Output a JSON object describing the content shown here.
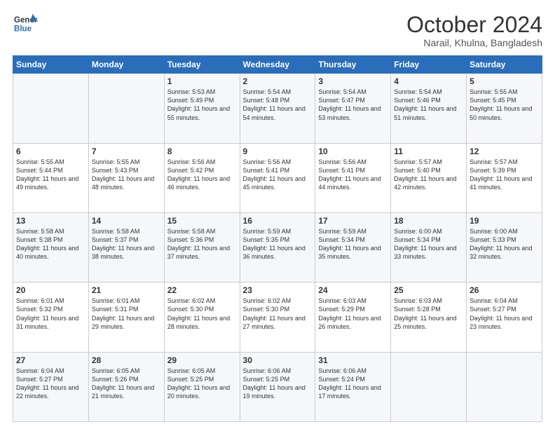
{
  "logo": {
    "line1": "General",
    "line2": "Blue"
  },
  "title": "October 2024",
  "subtitle": "Narail, Khulna, Bangladesh",
  "days_of_week": [
    "Sunday",
    "Monday",
    "Tuesday",
    "Wednesday",
    "Thursday",
    "Friday",
    "Saturday"
  ],
  "weeks": [
    [
      {
        "day": "",
        "content": ""
      },
      {
        "day": "",
        "content": ""
      },
      {
        "day": "1",
        "content": "Sunrise: 5:53 AM\nSunset: 5:49 PM\nDaylight: 11 hours and 55 minutes."
      },
      {
        "day": "2",
        "content": "Sunrise: 5:54 AM\nSunset: 5:48 PM\nDaylight: 11 hours and 54 minutes."
      },
      {
        "day": "3",
        "content": "Sunrise: 5:54 AM\nSunset: 5:47 PM\nDaylight: 11 hours and 53 minutes."
      },
      {
        "day": "4",
        "content": "Sunrise: 5:54 AM\nSunset: 5:46 PM\nDaylight: 11 hours and 51 minutes."
      },
      {
        "day": "5",
        "content": "Sunrise: 5:55 AM\nSunset: 5:45 PM\nDaylight: 11 hours and 50 minutes."
      }
    ],
    [
      {
        "day": "6",
        "content": "Sunrise: 5:55 AM\nSunset: 5:44 PM\nDaylight: 11 hours and 49 minutes."
      },
      {
        "day": "7",
        "content": "Sunrise: 5:55 AM\nSunset: 5:43 PM\nDaylight: 11 hours and 48 minutes."
      },
      {
        "day": "8",
        "content": "Sunrise: 5:56 AM\nSunset: 5:42 PM\nDaylight: 11 hours and 46 minutes."
      },
      {
        "day": "9",
        "content": "Sunrise: 5:56 AM\nSunset: 5:41 PM\nDaylight: 11 hours and 45 minutes."
      },
      {
        "day": "10",
        "content": "Sunrise: 5:56 AM\nSunset: 5:41 PM\nDaylight: 11 hours and 44 minutes."
      },
      {
        "day": "11",
        "content": "Sunrise: 5:57 AM\nSunset: 5:40 PM\nDaylight: 11 hours and 42 minutes."
      },
      {
        "day": "12",
        "content": "Sunrise: 5:57 AM\nSunset: 5:39 PM\nDaylight: 11 hours and 41 minutes."
      }
    ],
    [
      {
        "day": "13",
        "content": "Sunrise: 5:58 AM\nSunset: 5:38 PM\nDaylight: 11 hours and 40 minutes."
      },
      {
        "day": "14",
        "content": "Sunrise: 5:58 AM\nSunset: 5:37 PM\nDaylight: 11 hours and 38 minutes."
      },
      {
        "day": "15",
        "content": "Sunrise: 5:58 AM\nSunset: 5:36 PM\nDaylight: 11 hours and 37 minutes."
      },
      {
        "day": "16",
        "content": "Sunrise: 5:59 AM\nSunset: 5:35 PM\nDaylight: 11 hours and 36 minutes."
      },
      {
        "day": "17",
        "content": "Sunrise: 5:59 AM\nSunset: 5:34 PM\nDaylight: 11 hours and 35 minutes."
      },
      {
        "day": "18",
        "content": "Sunrise: 6:00 AM\nSunset: 5:34 PM\nDaylight: 11 hours and 33 minutes."
      },
      {
        "day": "19",
        "content": "Sunrise: 6:00 AM\nSunset: 5:33 PM\nDaylight: 11 hours and 32 minutes."
      }
    ],
    [
      {
        "day": "20",
        "content": "Sunrise: 6:01 AM\nSunset: 5:32 PM\nDaylight: 11 hours and 31 minutes."
      },
      {
        "day": "21",
        "content": "Sunrise: 6:01 AM\nSunset: 5:31 PM\nDaylight: 11 hours and 29 minutes."
      },
      {
        "day": "22",
        "content": "Sunrise: 6:02 AM\nSunset: 5:30 PM\nDaylight: 11 hours and 28 minutes."
      },
      {
        "day": "23",
        "content": "Sunrise: 6:02 AM\nSunset: 5:30 PM\nDaylight: 11 hours and 27 minutes."
      },
      {
        "day": "24",
        "content": "Sunrise: 6:03 AM\nSunset: 5:29 PM\nDaylight: 11 hours and 26 minutes."
      },
      {
        "day": "25",
        "content": "Sunrise: 6:03 AM\nSunset: 5:28 PM\nDaylight: 11 hours and 25 minutes."
      },
      {
        "day": "26",
        "content": "Sunrise: 6:04 AM\nSunset: 5:27 PM\nDaylight: 11 hours and 23 minutes."
      }
    ],
    [
      {
        "day": "27",
        "content": "Sunrise: 6:04 AM\nSunset: 5:27 PM\nDaylight: 11 hours and 22 minutes."
      },
      {
        "day": "28",
        "content": "Sunrise: 6:05 AM\nSunset: 5:26 PM\nDaylight: 11 hours and 21 minutes."
      },
      {
        "day": "29",
        "content": "Sunrise: 6:05 AM\nSunset: 5:25 PM\nDaylight: 11 hours and 20 minutes."
      },
      {
        "day": "30",
        "content": "Sunrise: 6:06 AM\nSunset: 5:25 PM\nDaylight: 11 hours and 19 minutes."
      },
      {
        "day": "31",
        "content": "Sunrise: 6:06 AM\nSunset: 5:24 PM\nDaylight: 11 hours and 17 minutes."
      },
      {
        "day": "",
        "content": ""
      },
      {
        "day": "",
        "content": ""
      }
    ]
  ]
}
